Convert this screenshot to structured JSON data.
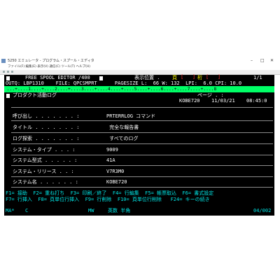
{
  "window": {
    "title": "5250 エミュレータ - プログラム・スプール・エディタ",
    "menu": "ファイル(F)  編集(E)  表示(V)  通信(C)  ツール(T)  ヘルプ(H)",
    "minimize": "–",
    "maximize": "□",
    "close": "✕"
  },
  "header": {
    "app_title": "FREE SPOOL EDITOR /400",
    "position_label": "表示位置 .",
    "page_label": "頁",
    "col_label": "桁",
    "page_count": "1/1",
    "outq_line": "OUTQ: LBP1310    FILE: QPCSMPRT      PAGESIZE L:  66 W: 132  LPI:  6.0 CPI: 10.0",
    "ruler": " ...+....1....+....2....+....3....+....4....+....5....+....6....+....7....+....8",
    "program_title": "プロダクト活動ログ",
    "page_ref": "ページ . :",
    "system_id": "KOBE720",
    "date": "11/03/21",
    "time": "08:45:0"
  },
  "fields": [
    {
      "label": "呼び出し . . . . . . . :",
      "value": "PRTERRLOG コマンド"
    },
    {
      "label": "タイトル . . . . . . . :",
      "value": " 完全な報告書"
    },
    {
      "label": "ログ探索 . . . . . . . :",
      "value": " すべてのログ"
    },
    {
      "label": "システム・タイプ . . . :",
      "value": "9009"
    },
    {
      "label": "システム型式 . . . . . :",
      "value": "41A"
    },
    {
      "label": "システム・リリース . . :",
      "value": "V7R3M0"
    },
    {
      "label": "システム名 . . . . . . :",
      "value": "KOBE720"
    }
  ],
  "function_keys": {
    "line1": "F1= 接助  F2= 重ね打ち  F3= 印刷／終了  F4= 行編集  F5= 帳票取込  F6= 書式設定",
    "line2": "F7= 行挿入  F8= 頁単位行挿入  F9= 行削除  F10= 頁単位行削除   F24= キーの続き"
  },
  "status": {
    "session": "MA*",
    "field": "C",
    "mode": "MW",
    "input_mode": "英数 半角",
    "cursor": "04/002"
  },
  "colors": {
    "screen_bg": "#000000",
    "ruler_bg": "#00ff66",
    "field_text": "#ffffff",
    "key_text": "#00e5e5"
  }
}
